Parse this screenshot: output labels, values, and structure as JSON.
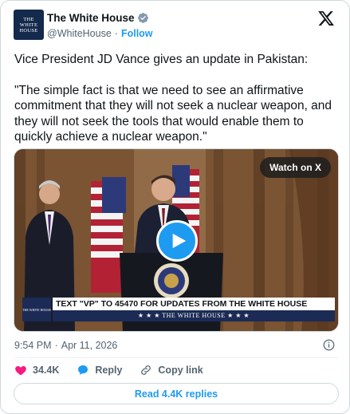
{
  "header": {
    "avatar_lines": [
      "THE",
      "WHITE",
      "HOUSE"
    ],
    "account_name": "The White House",
    "handle": "@WhiteHouse",
    "separator": "·",
    "follow_label": "Follow"
  },
  "tweet": {
    "paragraphs": [
      "Vice President JD Vance gives an update in Pakistan:",
      "\"The simple fact is that we need to see an affirmative commitment that they will not seek a nuclear weapon, and they will not seek the tools that would enable them to quickly achieve a nuclear weapon.\""
    ]
  },
  "media": {
    "watch_label": "Watch on X",
    "banner_logo_text": "THE WHITE HOUSE",
    "banner_text": "TEXT \"VP\" TO 45470 FOR UPDATES FROM THE WHITE HOUSE",
    "banner_subtext": "★ ★ ★  THE WHITE HOUSE  ★ ★ ★"
  },
  "meta": {
    "time": "9:54 PM",
    "separator": "·",
    "date": "Apr 11, 2026"
  },
  "actions": {
    "like_count": "34.4K",
    "reply_label": "Reply",
    "copy_link_label": "Copy link"
  },
  "replies_button_label": "Read 4.4K replies",
  "colors": {
    "accent": "#1d9bf0",
    "like": "#f91880",
    "text": "#0f1419",
    "secondary": "#536471",
    "border": "#cfd9de"
  }
}
